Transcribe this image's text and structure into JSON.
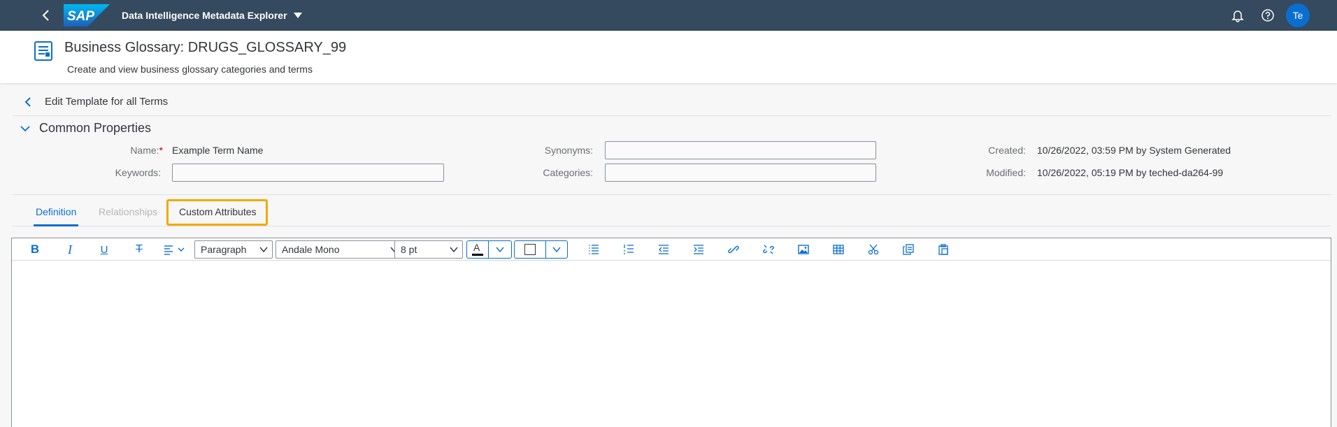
{
  "shell": {
    "title": "Data Intelligence Metadata Explorer",
    "logo_text": "SAP",
    "avatar_initials": "Te",
    "icons": [
      "back-icon",
      "bell-icon",
      "help-icon"
    ]
  },
  "header": {
    "title": "Business Glossary: DRUGS_GLOSSARY_99",
    "subtitle": "Create and view business glossary categories and terms"
  },
  "edit": {
    "title": "Edit Template for all Terms"
  },
  "common": {
    "section_title": "Common Properties",
    "name_label": "Name:",
    "name_required": "*",
    "name_value": "Example Term Name",
    "keywords_label": "Keywords:",
    "keywords_value": "",
    "synonyms_label": "Synonyms:",
    "synonyms_value": "",
    "categories_label": "Categories:",
    "categories_value": "",
    "created_label": "Created:",
    "created_value": "10/26/2022, 03:59 PM by System Generated",
    "modified_label": "Modified:",
    "modified_value": "10/26/2022, 05:19 PM by teched-da264-99"
  },
  "tabs": [
    {
      "label": "Definition",
      "state": "active"
    },
    {
      "label": "Relationships",
      "state": "disabled"
    },
    {
      "label": "Custom Attributes",
      "state": "highlighted"
    }
  ],
  "toolbar": {
    "block_format": "Paragraph",
    "font_family": "Andale Mono",
    "font_size": "8 pt",
    "text_color_glyph": "A",
    "buttons": [
      "bold-icon",
      "italic-icon",
      "underline-icon",
      "strikethrough-icon",
      "align-icon",
      "bullet-list-icon",
      "numbered-list-icon",
      "outdent-icon",
      "indent-icon",
      "link-icon",
      "unlink-icon",
      "image-icon",
      "table-icon",
      "cut-icon",
      "copy-icon",
      "paste-icon"
    ]
  },
  "colors": {
    "shell": "#354a5f",
    "accent": "#0a6ed1",
    "highlight": "#f0ab00",
    "required": "#bb0000"
  }
}
